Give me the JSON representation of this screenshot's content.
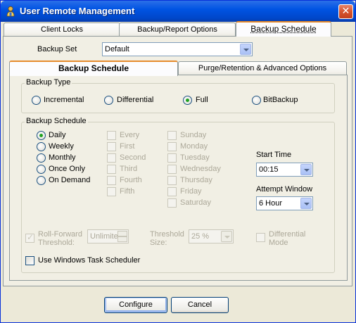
{
  "window": {
    "title": "User Remote Management",
    "close_glyph": "✕"
  },
  "top_tabs": [
    "Client Locks",
    "Backup/Report Options",
    "Backup Schedule"
  ],
  "backup_set": {
    "label": "Backup Set",
    "value": "Default"
  },
  "inner_tabs": [
    "Backup Schedule",
    "Purge/Retention & Advanced Options"
  ],
  "backup_type": {
    "label": "Backup Type",
    "options": [
      "Incremental",
      "Differential",
      "Full",
      "BitBackup"
    ],
    "selected": "Full"
  },
  "schedule": {
    "label": "Backup Schedule",
    "frequencies": [
      "Daily",
      "Weekly",
      "Monthly",
      "Once Only",
      "On Demand"
    ],
    "selected": "Daily",
    "occurrences": [
      "Every",
      "First",
      "Second",
      "Third",
      "Fourth",
      "Fifth"
    ],
    "weekdays": [
      "Sunday",
      "Monday",
      "Tuesday",
      "Wednesday",
      "Thursday",
      "Friday",
      "Saturday"
    ],
    "start_time": {
      "label": "Start Time",
      "value": "00:15"
    },
    "attempt_window": {
      "label": "Attempt Window",
      "value": "6 Hour"
    },
    "roll_forward": {
      "label_1": "Roll-Forward",
      "label_2": "Threshold:",
      "value": "Unlimite",
      "checked": true
    },
    "threshold_size": {
      "label_1": "Threshold",
      "label_2": "Size:",
      "value": "25 %"
    },
    "differential_mode": {
      "label_1": "Differential",
      "label_2": "Mode"
    },
    "windows_task_scheduler": {
      "label": "Use Windows Task Scheduler",
      "checked": false
    }
  },
  "buttons": {
    "configure": "Configure",
    "cancel": "Cancel"
  },
  "colors": {
    "titlebar": "#0054e3",
    "face": "#ece9d8",
    "tab_accent": "#e68b2c",
    "radio_dot": "#21a121",
    "disabled_text": "#aca899"
  }
}
